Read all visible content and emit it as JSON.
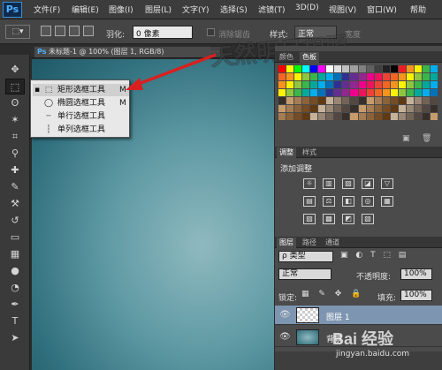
{
  "app": {
    "logo": "Ps"
  },
  "menu": [
    "文件(F)",
    "编辑(E)",
    "图像(I)",
    "图层(L)",
    "文字(Y)",
    "选择(S)",
    "滤镜(T)",
    "3D(D)",
    "视图(V)",
    "窗口(W)",
    "帮助"
  ],
  "options": {
    "feather_label": "羽化:",
    "feather_value": "0 像素",
    "antialias_label": "消除锯齿",
    "style_label": "样式:",
    "style_value": "正常",
    "width_label": "宽度"
  },
  "document": {
    "tab_title": "未标题-1 @ 100% (图层 1, RGB/8)"
  },
  "flyout": {
    "items": [
      {
        "icon": "rect-marquee-icon",
        "glyph": "⬚",
        "label": "矩形选框工具",
        "key": "M",
        "selected": true
      },
      {
        "icon": "ellipse-marquee-icon",
        "glyph": "◯",
        "label": "椭圆选框工具",
        "key": "M",
        "selected": false
      },
      {
        "icon": "row-marquee-icon",
        "glyph": "┄",
        "label": "单行选框工具",
        "key": "",
        "selected": false
      },
      {
        "icon": "column-marquee-icon",
        "glyph": "┆",
        "label": "单列选框工具",
        "key": "",
        "selected": false
      }
    ]
  },
  "watermark": "天然明月相照",
  "tools": [
    {
      "name": "move-tool",
      "glyph": "✥"
    },
    {
      "name": "marquee-tool",
      "glyph": "⬚",
      "active": true
    },
    {
      "name": "lasso-tool",
      "glyph": "ʘ"
    },
    {
      "name": "magic-wand-tool",
      "glyph": "✶"
    },
    {
      "name": "crop-tool",
      "glyph": "⌗"
    },
    {
      "name": "eyedropper-tool",
      "glyph": "⚲"
    },
    {
      "name": "healing-brush-tool",
      "glyph": "✚"
    },
    {
      "name": "brush-tool",
      "glyph": "✎"
    },
    {
      "name": "clone-stamp-tool",
      "glyph": "⚒"
    },
    {
      "name": "history-brush-tool",
      "glyph": "↺"
    },
    {
      "name": "eraser-tool",
      "glyph": "▭"
    },
    {
      "name": "gradient-tool",
      "glyph": "▦"
    },
    {
      "name": "blur-tool",
      "glyph": "●"
    },
    {
      "name": "dodge-tool",
      "glyph": "◔"
    },
    {
      "name": "pen-tool",
      "glyph": "✒"
    },
    {
      "name": "type-tool",
      "glyph": "T"
    },
    {
      "name": "path-selection-tool",
      "glyph": "➤"
    }
  ],
  "swatch_panel": {
    "tabs": [
      "颜色",
      "色板"
    ],
    "active": 1
  },
  "adjust_panel": {
    "tabs": [
      "调整",
      "样式"
    ],
    "active": 0,
    "title": "添加调整"
  },
  "layers_panel": {
    "tabs": [
      "图层",
      "路径",
      "通道"
    ],
    "active": 0,
    "filter_kind": "ρ 类型",
    "blend_mode": "正常",
    "opacity_label": "不透明度:",
    "opacity_value": "100%",
    "lock_label": "锁定:",
    "fill_label": "填充:",
    "fill_value": "100%",
    "layers": [
      {
        "name": "图层 1",
        "selected": true
      },
      {
        "name": "背景",
        "selected": false
      }
    ]
  },
  "site_watermark": {
    "brand": "Bai 经验",
    "url": "jingyan.baidu.com"
  },
  "colors": {
    "accent": "#2d6fd0",
    "arrow": "#d82020"
  }
}
